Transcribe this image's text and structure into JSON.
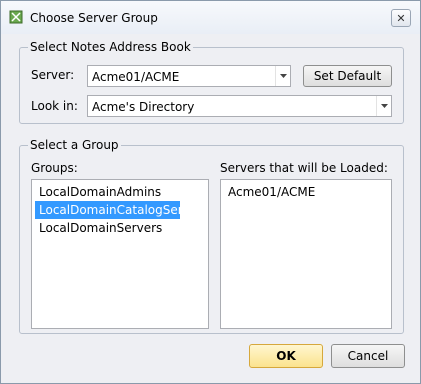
{
  "window": {
    "title": "Choose Server Group",
    "close_glyph": "✕"
  },
  "address_book": {
    "group_title": "Select Notes Address Book",
    "server_label": "Server:",
    "server_value": "Acme01/ACME",
    "set_default_label": "Set Default",
    "lookin_label": "Look in:",
    "lookin_value": "Acme's Directory"
  },
  "group_select": {
    "group_title": "Select a Group",
    "groups_label": "Groups:",
    "groups": [
      {
        "label": "LocalDomainAdmins",
        "selected": false
      },
      {
        "label": "LocalDomainCatalogSer...",
        "selected": true
      },
      {
        "label": "LocalDomainServers",
        "selected": false
      }
    ],
    "servers_label": "Servers that will be Loaded:",
    "servers": [
      {
        "label": "Acme01/ACME"
      }
    ]
  },
  "footer": {
    "ok_label": "OK",
    "cancel_label": "Cancel"
  },
  "colors": {
    "selection": "#3399ff",
    "ok_button": "#fbe38e"
  },
  "icons": {
    "app": "notes-server-icon",
    "dropdown": "chevron-down-icon",
    "close": "close-icon"
  }
}
